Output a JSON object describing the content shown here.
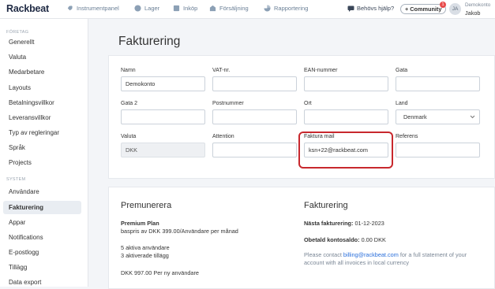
{
  "app": {
    "logo": "Rackbeat"
  },
  "nav": [
    {
      "label": "Instrumentpanel",
      "icon": "rocket-icon"
    },
    {
      "label": "Lager",
      "icon": "box-icon"
    },
    {
      "label": "Inköp",
      "icon": "cart-icon"
    },
    {
      "label": "Försäljning",
      "icon": "shop-icon"
    },
    {
      "label": "Rapportering",
      "icon": "pie-chart-icon"
    }
  ],
  "header": {
    "help": "Behövs hjälp?",
    "community": "+ Community",
    "community_badge": "1",
    "avatar_initials": "JA",
    "user_company": "Demokonto",
    "user_name": "Jakob"
  },
  "sidebar": {
    "section_company": "FÖRETAG",
    "section_system": "SYSTEM",
    "company_items": [
      "Generellt",
      "Valuta",
      "Medarbetare",
      "Layouts",
      "Betalningsvillkor",
      "Leveransvillkor",
      "Typ av regleringar",
      "Språk",
      "Projects"
    ],
    "system_items": [
      "Användare",
      "Fakturering",
      "Appar",
      "Notifications",
      "E-postlogg",
      "Tillägg",
      "Data export"
    ],
    "active": "Fakturering"
  },
  "page": {
    "title": "Fakturering"
  },
  "form": {
    "namn": {
      "label": "Namn",
      "value": "Demokonto"
    },
    "vat": {
      "label": "VAT-nr.",
      "value": ""
    },
    "ean": {
      "label": "EAN-nummer",
      "value": ""
    },
    "gata": {
      "label": "Gata",
      "value": ""
    },
    "gata2": {
      "label": "Gata 2",
      "value": ""
    },
    "postnummer": {
      "label": "Postnummer",
      "value": ""
    },
    "ort": {
      "label": "Ort",
      "value": ""
    },
    "land": {
      "label": "Land",
      "value": "Denmark"
    },
    "valuta": {
      "label": "Valuta",
      "value": "DKK"
    },
    "attention": {
      "label": "Attention",
      "value": ""
    },
    "faktura_mail": {
      "label": "Faktura mail",
      "value": "ksn+22@rackbeat.com"
    },
    "referens": {
      "label": "Referens",
      "value": ""
    }
  },
  "subscription": {
    "title": "Premunerera",
    "plan": "Premium Plan",
    "price_line": "baspris av DKK 399.00/Användare per månad",
    "active_users": "5 aktiva användare",
    "active_addons": "3 aktiverade tillägg",
    "per_user": "DKK 997.00 Per ny användare"
  },
  "billing": {
    "title": "Fakturering",
    "next_label": "Nästa fakturering:",
    "next_value": "01-12-2023",
    "balance_label": "Obetald kontosaldo:",
    "balance_value": "0.00 DKK",
    "contact_pre": "Please contact",
    "contact_email": "billing@rackbeat.com",
    "contact_post": "for a full statement of your",
    "contact_line2": "account with all invoices in local currency"
  },
  "colors": {
    "highlight": "#c8282d",
    "link": "#2a6fdb",
    "brand": "#1f2a44"
  }
}
